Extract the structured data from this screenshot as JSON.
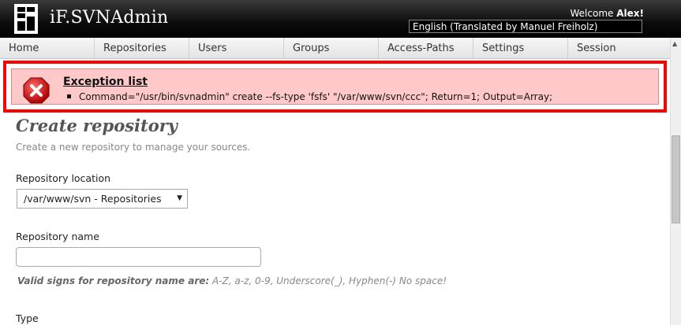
{
  "header": {
    "app_title": "iF.SVNAdmin",
    "welcome_prefix": "Welcome",
    "user_name": "Alex!",
    "language": "English (Translated by Manuel Freiholz)"
  },
  "nav": {
    "items": [
      "Home",
      "Repositories",
      "Users",
      "Groups",
      "Access-Paths",
      "Settings",
      "Session"
    ]
  },
  "exception": {
    "title": "Exception list",
    "items": [
      "Command=\"/usr/bin/svnadmin\" create --fs-type 'fsfs' \"/var/www/svn/ccc\"; Return=1; Output=Array;"
    ]
  },
  "page": {
    "title": "Create repository",
    "subtitle": "Create a new repository to manage your sources."
  },
  "form": {
    "location_label": "Repository location",
    "location_value": "/var/www/svn - Repositories",
    "name_label": "Repository name",
    "name_value": "",
    "hint_bold": "Valid signs for repository name are:",
    "hint_rest": " A-Z, a-z, 0-9, Underscore(_), Hyphen(-) No space!",
    "type_label": "Type"
  },
  "colors": {
    "highlight_border": "#ff0000",
    "exception_bg": "#ffc9c9",
    "header_bg": "#000000"
  }
}
